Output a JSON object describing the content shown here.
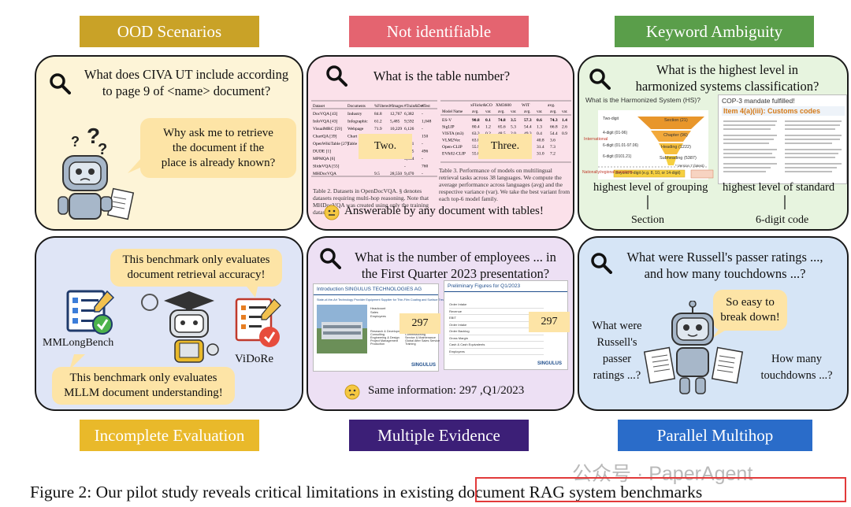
{
  "banners": {
    "ood": "OOD Scenarios",
    "not_identifiable": "Not identifiable",
    "keyword_ambiguity": "Keyword Ambiguity",
    "incomplete_evaluation": "Incomplete Evaluation",
    "multiple_evidence": "Multiple Evidence",
    "parallel_multihop": "Parallel Multihop"
  },
  "ood_panel": {
    "question_line1": "What does CIVA UT include according",
    "question_line2": "to page 9 of <name> document?",
    "reply_line1": "Why ask me to retrieve",
    "reply_line2": "the document if the",
    "reply_line3": "place is already known?"
  },
  "not_identifiable_panel": {
    "question": "What is the table number?",
    "note_left": "Two.",
    "note_right": "Three.",
    "left_table": {
      "headers": [
        "Dataset",
        "Documents",
        "%Filtered",
        "#Images",
        "#Train&Dev",
        "#Test"
      ],
      "rows": [
        [
          "DocVQA [43]",
          "Industry",
          "84.8",
          "12,767",
          "6,382",
          "-"
        ],
        [
          "InfoVQA [43]",
          "Infographic",
          "61.2",
          "5,485",
          "9,592",
          "1,048"
        ],
        [
          "VisualMRC [59]",
          "Webpage",
          "71.9",
          "10,229",
          "6,126",
          "-"
        ],
        [
          "ChartQA [39]",
          "Chart",
          "94.0",
          "20,882",
          "-",
          "150"
        ],
        [
          "OpenWikiTable [27]",
          "Table",
          "0.0",
          "1,257",
          "4,261",
          "-"
        ],
        [
          "DUDE [1]",
          "",
          "",
          "",
          "2,135",
          "496"
        ],
        [
          "MPMQA [6]",
          "",
          "",
          "",
          "3,054",
          "-"
        ],
        [
          "SlideVQA [55]",
          "",
          "",
          "",
          "-",
          "760"
        ],
        [
          "MHDocVQA",
          "",
          "9.5",
          "28,550",
          "9,470",
          "-"
        ]
      ],
      "caption": "Table 2. Datasets in OpenDocVQA. § denotes datasets requiring multi-hop reasoning. Note that MHDocVQA was created using only the training datasets."
    },
    "right_table": {
      "group_headers": [
        "xFlickr&CO",
        "XM3600",
        "WIT",
        "avg."
      ],
      "sub_headers": [
        "Model Name",
        "avg.",
        "var.",
        "avg.",
        "var.",
        "avg.",
        "var.",
        "avg.",
        "var."
      ],
      "rows": [
        [
          "ES-V",
          "90.8",
          "0.1",
          "74.8",
          "3.5",
          "57.3",
          "0.6",
          "74.3",
          "1.4"
        ],
        [
          "SigLIP",
          "80.4",
          "1.2",
          "65.6",
          "5.3",
          "54.4",
          "1.3",
          "66.8",
          "2.6"
        ],
        [
          "VISTA (m3)",
          "63.3",
          "0.2",
          "48.5",
          "2.0",
          "49.3",
          "0.4",
          "54.4",
          "0.9"
        ],
        [
          "VLM2Vec",
          "63.8",
          "",
          "",
          "",
          "2.5",
          "40.8",
          "3.6",
          ""
        ],
        [
          "Open-CLIP",
          "55.9",
          "",
          "",
          "",
          "6.5",
          "31.4",
          "7.3",
          ""
        ],
        [
          "EVA02-CLIP",
          "55.0",
          "",
          "",
          "",
          "6.4",
          "31.0",
          "7.2",
          ""
        ]
      ],
      "caption": "Table 3. Performance of models on multilingual retrieval tasks across 38 languages. We compute the average performance across languages (avg) and the respective variance (var). We take the best variant from each top-6 model family."
    },
    "footer": "Answerable by any document with tables!"
  },
  "keyword_panel": {
    "question_line1": "What is the highest level in",
    "question_line2": "harmonized systems classification?",
    "left_doc_title": "What is the Harmonized System (HS)?",
    "pyramid_levels": [
      "Section (21)",
      "Chapter (96)",
      "Heading (1222)",
      "Subheading (5387)",
      "Beyond 6-digit (e.g. 8, 10, or 14-digit)"
    ],
    "pyramid_side_left": [
      "International",
      "Nationally/regional variations"
    ],
    "pyramid_left": [
      "Two-digit",
      "4-digit (01-96)",
      "6-digit (01.01-97.06)",
      "6-digit (0101.21)"
    ],
    "pyramid_note": "* Version 7 (latest)",
    "right_doc_header": "COP-3 mandate fulfilled!",
    "right_doc_title": "Item 4(a)(iii): Customs codes",
    "label_left": "highest level of grouping",
    "label_right": "highest level of standard",
    "answer_left": "Section",
    "answer_right": "6-digit code"
  },
  "incomplete_panel": {
    "bubble_top_line1": "This benchmark only evaluates",
    "bubble_top_line2": "document retrieval accuracy!",
    "bench_left": "MMLongBench",
    "bench_right": "ViDoRe",
    "bubble_bottom_line1": "This benchmark only evaluates",
    "bubble_bottom_line2": "MLLM document understanding!"
  },
  "multiple_evidence_panel": {
    "question_line1": "What is the number of employees ... in",
    "question_line2": "the First Quarter 2023 presentation?",
    "left_slide_title": "Introduction SINGULUS TECHNOLOGIES AG",
    "left_slide_subtitle": "State-of-the-Art Technology Provider Equipment Supplier for Thin-Film Coating and Surface Treatment",
    "left_slide_list1": [
      "Headcount",
      "Sales",
      "Employees"
    ],
    "left_slide_list2": [
      "Research & Development",
      "Consulting",
      "Engineering & Design",
      "Project Management",
      "Production"
    ],
    "left_slide_list3": [
      "Installation",
      "Commissioning",
      "Service & Maintenance",
      "Global After Sales Service",
      "Training"
    ],
    "left_slide_logo": "SINGULUS",
    "right_slide_title": "Preliminary Figures for Q1/2023",
    "right_slide_rows": [
      "Order Intake",
      "Revenue",
      "EBIT",
      "Order Intake",
      "Order Backlog",
      "Gross Margin",
      "Cash & Cash Equivalents",
      "Employees"
    ],
    "right_slide_logo": "SINGULUS",
    "note_left": "297",
    "note_right": "297",
    "footer": "Same information: 297 ,Q1/2023"
  },
  "parallel_panel": {
    "question_line1": "What were Russell's passer ratings ...,",
    "question_line2": "and how many touchdowns ...?",
    "bubble_line1": "So easy to",
    "bubble_line2": "break down!",
    "left_text": [
      "What were",
      "Russell's",
      "passer",
      "ratings ...?"
    ],
    "right_text": [
      "How many",
      "touchdowns ...?"
    ]
  },
  "caption": {
    "text": "Figure 2: Our pilot study reveals critical limitations in existing document RAG system benchmarks"
  },
  "watermark": "公众号 · PaperAgent",
  "colors": {
    "ood": "#c9a227",
    "not_identifiable": "#e46470",
    "keyword_ambiguity": "#5a9e4a",
    "incomplete_evaluation": "#e9b92a",
    "multiple_evidence": "#3c1f77",
    "parallel_multihop": "#2a6cc9",
    "bubble": "#fde4a6",
    "highlight_box": "#e23a3a"
  }
}
